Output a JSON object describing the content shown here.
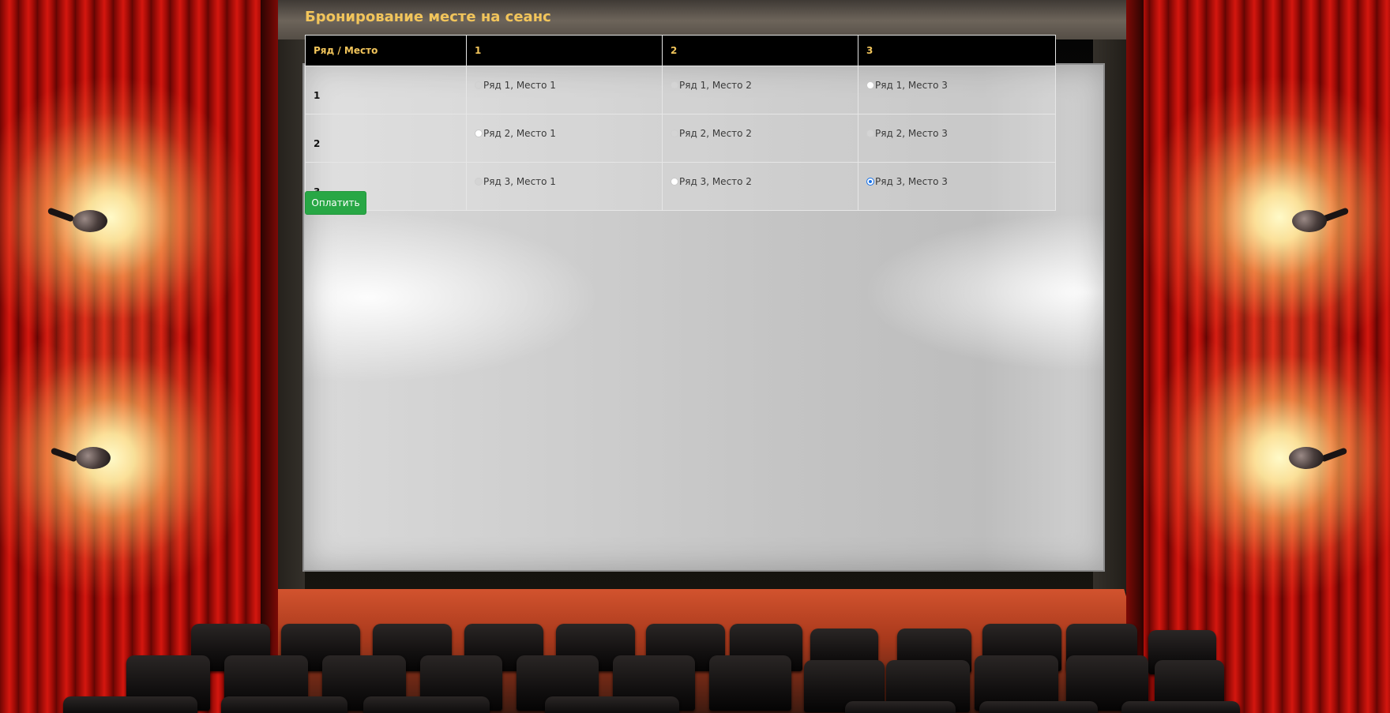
{
  "page": {
    "title": "Бронирование месте на сеанс"
  },
  "table": {
    "corner_header": "Ряд / Место",
    "columns": [
      "1",
      "2",
      "3"
    ],
    "rows": [
      {
        "label": "1",
        "seats": [
          {
            "label": "Ряд 1, Место 1",
            "state": "disabled"
          },
          {
            "label": "Ряд 1, Место 2",
            "state": "disabled"
          },
          {
            "label": "Ряд 1, Место 3",
            "state": "available"
          }
        ]
      },
      {
        "label": "2",
        "seats": [
          {
            "label": "Ряд 2, Место 1",
            "state": "available"
          },
          {
            "label": "Ряд 2, Место 2",
            "state": "disabled"
          },
          {
            "label": "Ряд 2, Место 3",
            "state": "disabled"
          }
        ]
      },
      {
        "label": "3",
        "seats": [
          {
            "label": "Ряд 3, Место 1",
            "state": "disabled"
          },
          {
            "label": "Ряд 3, Место 2",
            "state": "available"
          },
          {
            "label": "Ряд 3, Место 3",
            "state": "checked"
          }
        ]
      }
    ]
  },
  "actions": {
    "pay_label": "Оплатить"
  },
  "colors": {
    "title": "#f2c55b",
    "header_bg": "#000000",
    "pay_button": "#28a745",
    "radio_checked": "#1a73e8"
  }
}
